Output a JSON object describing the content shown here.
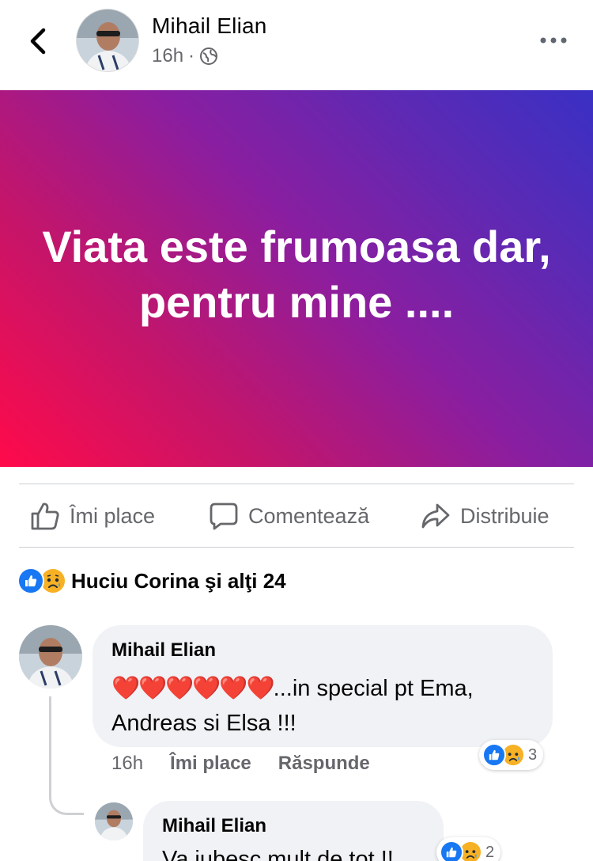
{
  "header": {
    "author": "Mihail Elian",
    "time": "16h",
    "separator": "·",
    "privacy_icon": "globe-icon",
    "back_icon": "chevron-left-icon",
    "more_icon": "more-horizontal-icon"
  },
  "post": {
    "text": "Viata este frumoasa dar, pentru mine ....",
    "gradient_colors": [
      "#ff0a4a",
      "#8a1ea0",
      "#3930c4"
    ]
  },
  "actions": {
    "like": "Îmi place",
    "comment": "Comentează",
    "share": "Distribuie"
  },
  "reactions": {
    "summary": "Huciu Corina şi alţi 24",
    "icons": [
      "like-reaction-icon",
      "sad-reaction-icon"
    ]
  },
  "comments": [
    {
      "author": "Mihail Elian",
      "hearts": "❤️❤️❤️❤️❤️❤️",
      "text_line1": "...in special pt Ema,",
      "text_line2": "Andreas si Elsa !!!",
      "time": "16h",
      "like_label": "Îmi place",
      "reply_label": "Răspunde",
      "reaction_count": "3"
    },
    {
      "author": "Mihail Elian",
      "text": "Va iubesc mult de tot !!",
      "reaction_count": "2"
    }
  ],
  "colors": {
    "facebook_blue": "#1877f2",
    "secondary_text": "#65676b",
    "bubble_bg": "#f0f2f5",
    "sad_yellow": "#f7b125"
  }
}
